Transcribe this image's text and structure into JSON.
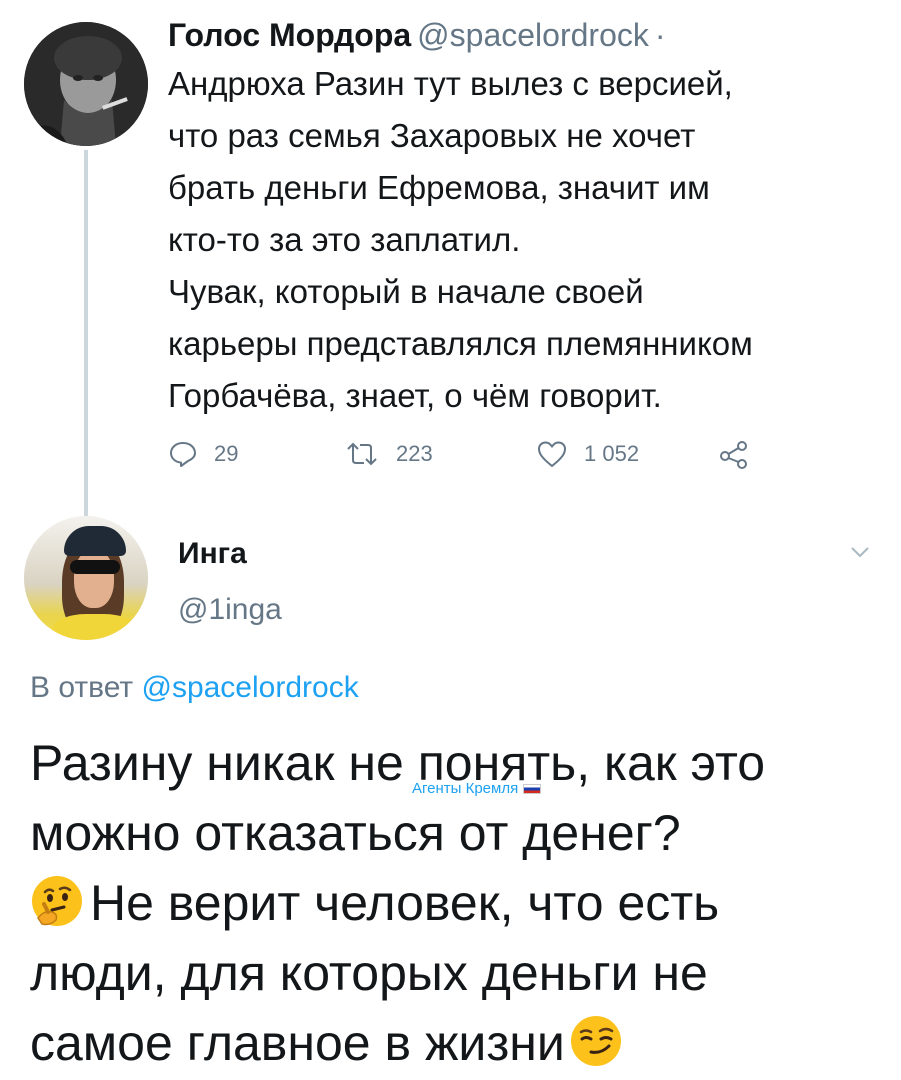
{
  "tweet": {
    "author_name": "Голос Мордора",
    "author_handle": "@spacelordrock",
    "separator": "·",
    "text": "Андрюха Разин тут вылез с версией,\nчто раз семья Захаровых не хочет\nбрать деньги Ефремова, значит им\nкто-то за это заплатил.\nЧувак, который в начале своей\nкарьеры представлялся племянником\nГорбачёва, знает, о чём говорит.",
    "actions": {
      "replies": "29",
      "retweets": "223",
      "likes": "1 052"
    }
  },
  "reply": {
    "author_name": "Инга",
    "author_handle": "@1inga",
    "reply_prefix": "В ответ",
    "reply_to_handle": "@spacelordrock",
    "text_lines": [
      "Разину никак не понять, как это",
      "можно отказаться от денег?",
      "Не верит человек, что есть",
      "люди, для которых деньги не",
      "самое главное в жизни"
    ],
    "emojis": {
      "line3_start": "thinking-face-emoji",
      "line5_end": "smirking-face-emoji"
    }
  },
  "watermark": {
    "text": "Агенты Кремля",
    "icon": "russian-flag-icon"
  },
  "colors": {
    "text": "#14171a",
    "secondary": "#657786",
    "link": "#1da1f2",
    "thread_line": "#ccd6dd"
  }
}
